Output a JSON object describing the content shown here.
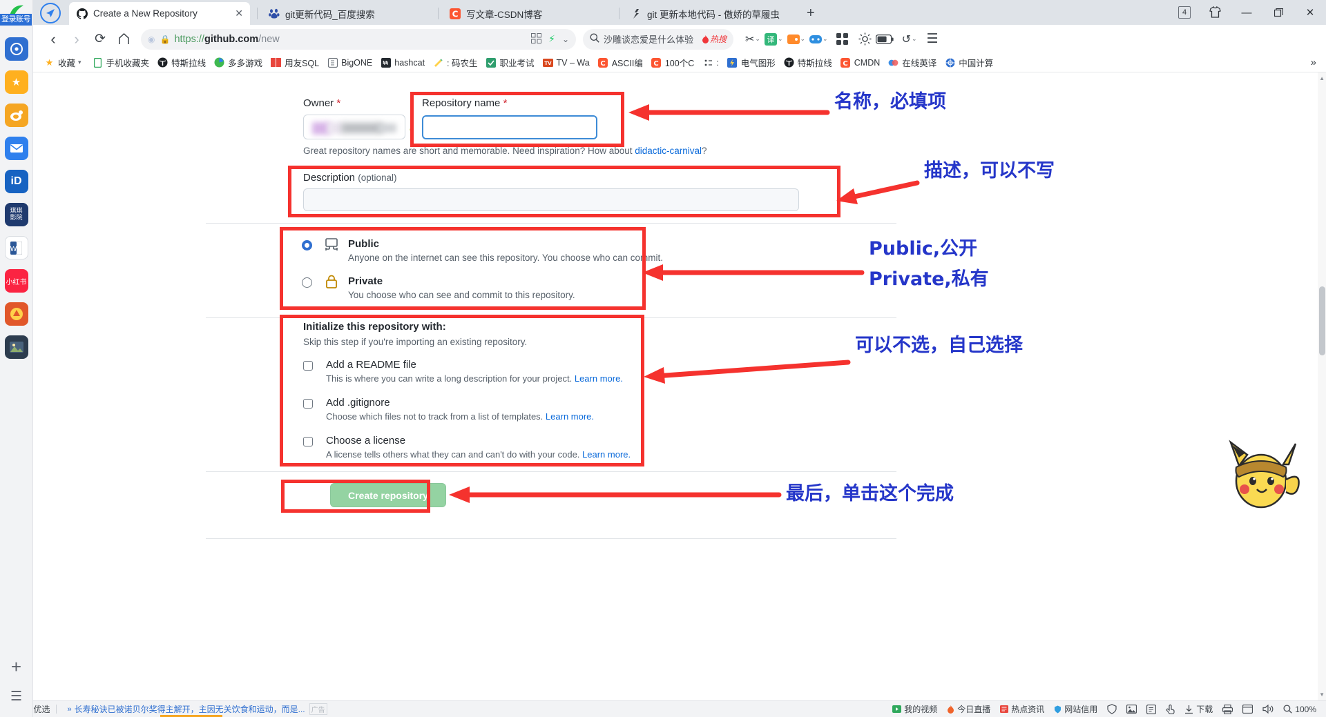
{
  "window": {
    "tab_count": "4",
    "controls": {
      "minimize": "—",
      "maximize": "❐",
      "close": "✕"
    }
  },
  "tabs": [
    {
      "title": "Create a New Repository",
      "favicon": "github-icon",
      "active": true,
      "close": "✕"
    },
    {
      "title": "git更新代码_百度搜索",
      "favicon": "baidu-icon",
      "active": false
    },
    {
      "title": "写文章-CSDN博客",
      "favicon": "csdn-icon",
      "active": false
    },
    {
      "title": "git 更新本地代码 - 傲娇的草履虫",
      "favicon": "blog-icon",
      "active": false
    }
  ],
  "newtab_label": "+",
  "toolbar": {
    "back": "‹",
    "forward": "›",
    "reload": "⟳",
    "home": "⌂",
    "url_shield_icon": "shield-icon",
    "url_lock_icon": "lock-icon",
    "url_scheme": "https://",
    "url_host": "github.com",
    "url_path": "/new",
    "url_qr_icon": "qrcode-icon",
    "url_bolt_icon": "bolt-icon",
    "url_chevron_icon": "chevron-down-icon",
    "search_icon": "search-icon",
    "search_value": "沙雕谈恋爱是什么体验",
    "search_badge": "热搜",
    "right_icons": [
      "scissors-icon",
      "translate-icon",
      "wallet-icon",
      "games-icon",
      "apps-grid-icon",
      "brightness-icon",
      "battery-icon",
      "undo-icon",
      "menu-icon"
    ]
  },
  "bookmarks": {
    "items": [
      {
        "label": "收藏",
        "icon": "star-icon",
        "caret": "▾"
      },
      {
        "label": "手机收藏夹",
        "icon": "mobile-icon"
      },
      {
        "label": "特斯拉线",
        "icon": "tesla-icon"
      },
      {
        "label": "多多游戏",
        "icon": "game-icon"
      },
      {
        "label": "用友SQL",
        "icon": "sql-icon"
      },
      {
        "label": "BigONE",
        "icon": "bigone-icon"
      },
      {
        "label": "hashcat",
        "icon": "hashcat-icon"
      },
      {
        "label": ": 码农生",
        "icon": "coder-icon"
      },
      {
        "label": "职业考试",
        "icon": "exam-icon"
      },
      {
        "label": "TV – Wa",
        "icon": "tv-icon"
      },
      {
        "label": "ASCII编",
        "icon": "ascii-icon"
      },
      {
        "label": "100个C",
        "icon": "hundred-icon"
      },
      {
        "label": ":",
        "icon": "dots-icon"
      },
      {
        "label": "电气图形",
        "icon": "electric-icon"
      },
      {
        "label": "特斯拉线",
        "icon": "tesla2-icon"
      },
      {
        "label": "CMDN",
        "icon": "cmdn-icon"
      },
      {
        "label": "在线英译",
        "icon": "translate2-icon"
      },
      {
        "label": "中国计算",
        "icon": "china-icon"
      }
    ],
    "overflow": "»"
  },
  "sidedock": {
    "badge": "登录账号",
    "items": [
      "browser-logo-icon",
      "star-icon",
      "weibo-icon",
      "mail-icon",
      "id-icon",
      "theme-icon",
      "word-icon",
      "xiaohongshu-icon",
      "game2-icon",
      "photo-icon"
    ],
    "add": "+",
    "menu": "☰"
  },
  "github_form": {
    "owner_label": "Owner",
    "owner_required": "*",
    "owner_value": "",
    "separator": "/",
    "repo_label": "Repository name",
    "repo_required": "*",
    "repo_value": "",
    "name_hint_pre": "Great repository names are short and memorable. Need inspiration? How about ",
    "name_hint_link": "didactic-carnival",
    "name_hint_post": "?",
    "description_label": "Description",
    "description_optional": "(optional)",
    "description_value": "",
    "visibility": [
      {
        "id": "public",
        "title": "Public",
        "icon": "repo-public-icon",
        "desc": "Anyone on the internet can see this repository. You choose who can commit.",
        "selected": true
      },
      {
        "id": "private",
        "title": "Private",
        "icon": "lock-private-icon",
        "desc": "You choose who can see and commit to this repository.",
        "selected": false
      }
    ],
    "init_title": "Initialize this repository with:",
    "init_subtitle": "Skip this step if you're importing an existing repository.",
    "init_options": [
      {
        "label": "Add a README file",
        "desc": "This is where you can write a long description for your project. ",
        "link": "Learn more.",
        "checked": false
      },
      {
        "label": "Add .gitignore",
        "desc": "Choose which files not to track from a list of templates. ",
        "link": "Learn more.",
        "checked": false
      },
      {
        "label": "Choose a license",
        "desc": "A license tells others what they can and can't do with your code. ",
        "link": "Learn more.",
        "checked": false
      }
    ],
    "create_button": "Create repository"
  },
  "annotations": [
    {
      "id": "name",
      "text": "名称，必填项"
    },
    {
      "id": "desc",
      "text": "描述，可以不写"
    },
    {
      "id": "vis1",
      "text": "Public,公开"
    },
    {
      "id": "vis2",
      "text": "Private,私有"
    },
    {
      "id": "init",
      "text": "可以不选，自己选择"
    },
    {
      "id": "create",
      "text": "最后，单击这个完成"
    }
  ],
  "bottombar": {
    "left": {
      "label": "今日优选",
      "icon": "sparkle-icon"
    },
    "news": "长寿秘诀已被诺贝尔奖得主解开，主因无关饮食和运动，而是...",
    "news_tag": "广告",
    "right_items": [
      {
        "label": "我的视频",
        "icon": "video-icon"
      },
      {
        "label": "今日直播",
        "icon": "live-icon"
      },
      {
        "label": "热点资讯",
        "icon": "news-icon"
      },
      {
        "label": "网站信用",
        "icon": "credit-icon"
      }
    ],
    "right_icons": [
      "shield-icon",
      "image-icon",
      "note-icon",
      "finger-icon",
      "download-icon",
      "print-icon",
      "window-icon",
      "volume-icon"
    ],
    "zoom_label": "100%",
    "zoom_icon": "magnifier-icon"
  }
}
